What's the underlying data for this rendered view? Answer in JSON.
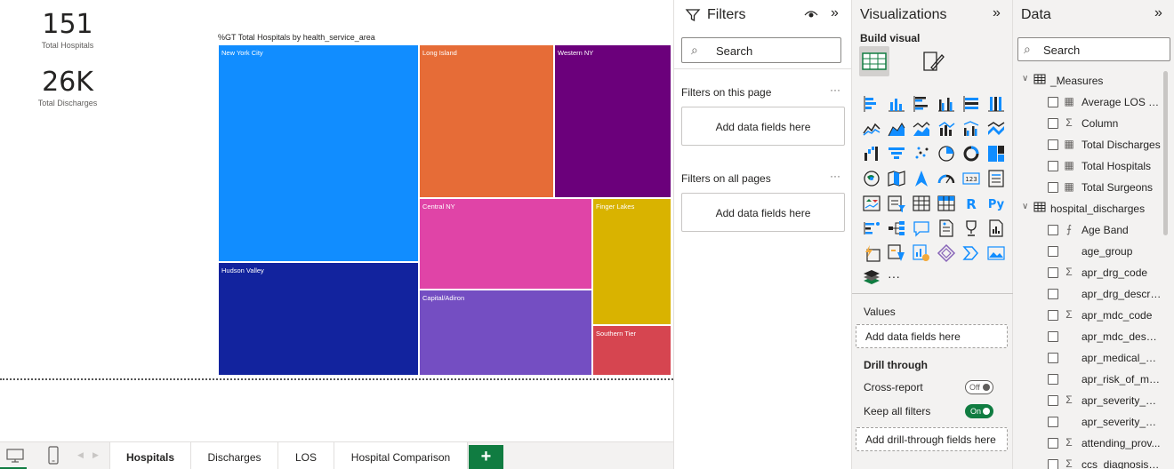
{
  "cards": [
    {
      "value": "151",
      "label": "Total Hospitals"
    },
    {
      "value": "26K",
      "label": "Total Discharges"
    }
  ],
  "treemap": {
    "title": "%GT Total Hospitals by health_service_area",
    "tiles": [
      {
        "label": "New York City",
        "color": "#118dff"
      },
      {
        "label": "Hudson Valley",
        "color": "#12239e"
      },
      {
        "label": "Long Island",
        "color": "#e66c37"
      },
      {
        "label": "Western NY",
        "color": "#6b007b"
      },
      {
        "label": "Central NY",
        "color": "#e044a7"
      },
      {
        "label": "Capital/Adiron",
        "color": "#744ec2"
      },
      {
        "label": "Finger Lakes",
        "color": "#d9b300"
      },
      {
        "label": "Southern Tier",
        "color": "#d64550"
      }
    ]
  },
  "tabs": [
    "Hospitals",
    "Discharges",
    "LOS",
    "Hospital Comparison"
  ],
  "add_page": "+",
  "filters": {
    "title": "Filters",
    "search_placeholder": "Search",
    "on_page_label": "Filters on this page",
    "all_pages_label": "Filters on all pages",
    "dropzone_text": "Add data fields here",
    "more": "···"
  },
  "visualizations": {
    "title": "Visualizations",
    "build_label": "Build visual",
    "more": "···",
    "values_label": "Values",
    "values_drop": "Add data fields here",
    "drill_label": "Drill through",
    "cross_report_label": "Cross-report",
    "cross_report_state": "Off",
    "keep_filters_label": "Keep all filters",
    "keep_filters_state": "On",
    "drill_drop": "Add drill-through fields here"
  },
  "data_pane": {
    "title": "Data",
    "search_placeholder": "Search",
    "tables": [
      {
        "name": "_Measures",
        "fields": [
          {
            "type": "calc",
            "name": "Average LOS D..."
          },
          {
            "type": "sum",
            "name": "Column"
          },
          {
            "type": "calc",
            "name": "Total Discharges"
          },
          {
            "type": "calc",
            "name": "Total Hospitals"
          },
          {
            "type": "calc",
            "name": "Total Surgeons"
          }
        ]
      },
      {
        "name": "hospital_discharges",
        "fields": [
          {
            "type": "fx",
            "name": "Age Band"
          },
          {
            "type": "none",
            "name": "age_group"
          },
          {
            "type": "sum",
            "name": "apr_drg_code"
          },
          {
            "type": "none",
            "name": "apr_drg_descri..."
          },
          {
            "type": "sum",
            "name": "apr_mdc_code"
          },
          {
            "type": "none",
            "name": "apr_mdc_descri..."
          },
          {
            "type": "none",
            "name": "apr_medical_su..."
          },
          {
            "type": "none",
            "name": "apr_risk_of_mo..."
          },
          {
            "type": "sum",
            "name": "apr_severity_of..."
          },
          {
            "type": "none",
            "name": "apr_severity_of..."
          },
          {
            "type": "sum",
            "name": "attending_prov..."
          },
          {
            "type": "sum",
            "name": "ccs_diagnosis_c..."
          }
        ]
      }
    ]
  }
}
